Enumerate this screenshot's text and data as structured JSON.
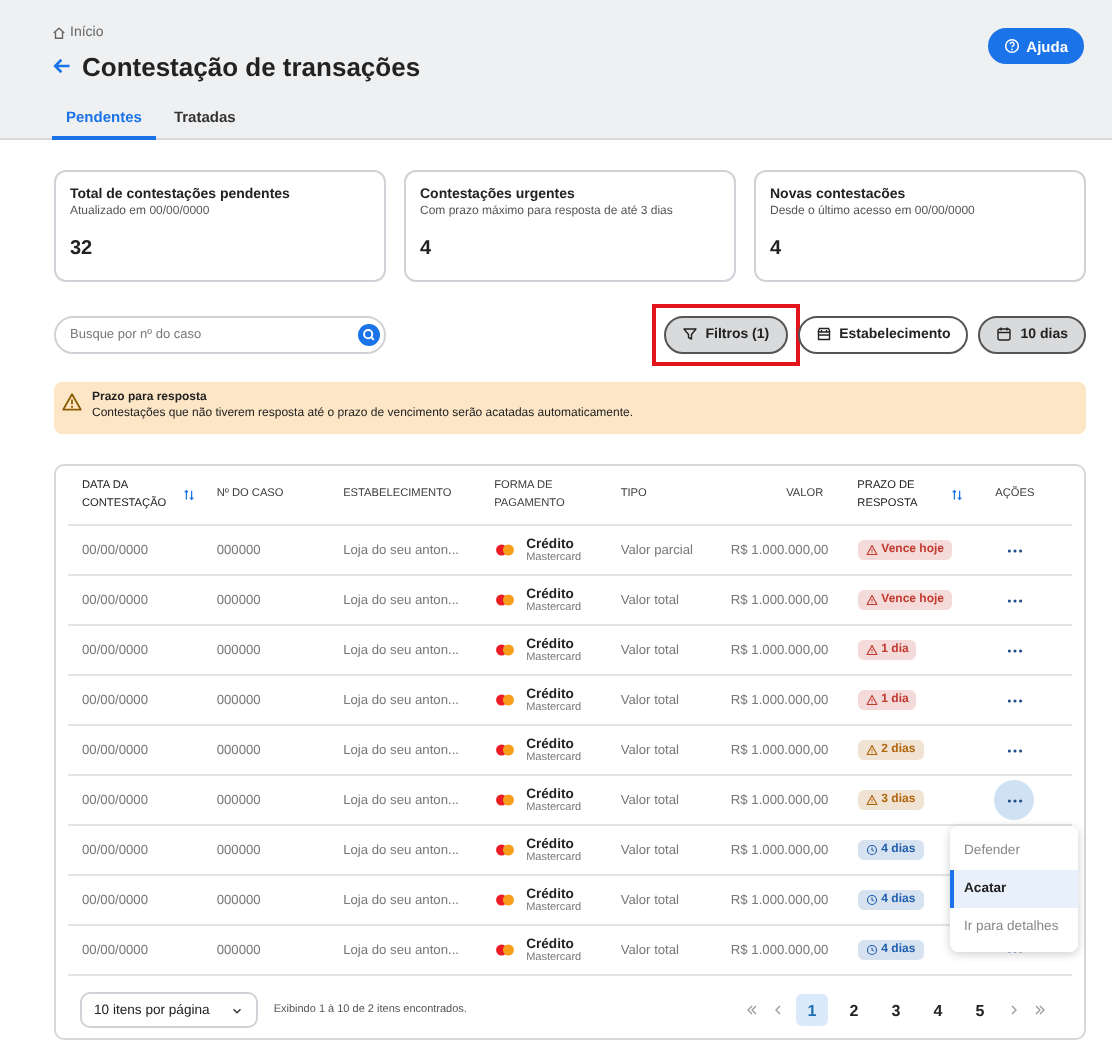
{
  "breadcrumb": "Início",
  "title": "Contestação de transações",
  "help_button": "Ajuda",
  "tabs": [
    {
      "label": "Pendentes",
      "selected": true
    },
    {
      "label": "Tratadas",
      "selected": false
    }
  ],
  "cards": [
    {
      "title": "Total de contestações pendentes",
      "subtitle": "Atualizado em 00/00/0000",
      "value": "32"
    },
    {
      "title": "Contestações urgentes",
      "subtitle": "Com prazo máximo para resposta de até 3 dias",
      "value": "4"
    },
    {
      "title": "Novas contestacões",
      "subtitle": "Desde o último acesso em 00/00/0000",
      "value": "4"
    }
  ],
  "search": {
    "placeholder": "Busque por nº do caso"
  },
  "filters": [
    {
      "kind": "filter",
      "label": "Filtros (1)",
      "active": true,
      "highlighted": true
    },
    {
      "kind": "store",
      "label": "Estabelecimento",
      "active": false,
      "highlighted": false
    },
    {
      "kind": "calendar",
      "label": "10 dias",
      "active": true,
      "highlighted": false
    }
  ],
  "alert": {
    "title": "Prazo para resposta",
    "text": "Contestações que não tiverem resposta até o prazo de vencimento serão acatadas automaticamente."
  },
  "table": {
    "columns": [
      {
        "label": "DATA DA CONTESTAÇÃO",
        "sortable": true
      },
      {
        "label": "Nº DO CASO",
        "sortable": false
      },
      {
        "label": "ESTABELECIMENTO",
        "sortable": false
      },
      {
        "label": "FORMA DE PAGAMENTO",
        "sortable": false
      },
      {
        "label": "TIPO",
        "sortable": false
      },
      {
        "label": "VALOR",
        "sortable": false
      },
      {
        "label": "PRAZO DE RESPOSTA",
        "sortable": true
      },
      {
        "label": "AÇÕES",
        "sortable": false
      }
    ],
    "rows": [
      {
        "date": "00/00/0000",
        "case": "000000",
        "store": "Loja do seu anton...",
        "payment": "Crédito",
        "brand": "Mastercard",
        "type": "Valor parcial",
        "value": "R$ 1.000.000,00",
        "deadline": "Vence hoje",
        "kind": "warning",
        "color": "#c2392f",
        "actions": true,
        "menu_open": false
      },
      {
        "date": "00/00/0000",
        "case": "000000",
        "store": "Loja do seu anton...",
        "payment": "Crédito",
        "brand": "Mastercard",
        "type": "Valor total",
        "value": "R$ 1.000.000,00",
        "deadline": "Vence hoje",
        "kind": "warning",
        "color": "#c2392f",
        "actions": true,
        "menu_open": false
      },
      {
        "date": "00/00/0000",
        "case": "000000",
        "store": "Loja do seu anton...",
        "payment": "Crédito",
        "brand": "Mastercard",
        "type": "Valor total",
        "value": "R$ 1.000.000,00",
        "deadline": "1 dia",
        "kind": "warning",
        "color": "#c2392f",
        "actions": true,
        "menu_open": false
      },
      {
        "date": "00/00/0000",
        "case": "000000",
        "store": "Loja do seu anton...",
        "payment": "Crédito",
        "brand": "Mastercard",
        "type": "Valor total",
        "value": "R$ 1.000.000,00",
        "deadline": "1 dia",
        "kind": "warning",
        "color": "#c2392f",
        "actions": true,
        "menu_open": false
      },
      {
        "date": "00/00/0000",
        "case": "000000",
        "store": "Loja do seu anton...",
        "payment": "Crédito",
        "brand": "Mastercard",
        "type": "Valor total",
        "value": "R$ 1.000.000,00",
        "deadline": "2 dias",
        "kind": "warning",
        "color": "#b0650a",
        "actions": true,
        "menu_open": false
      },
      {
        "date": "00/00/0000",
        "case": "000000",
        "store": "Loja do seu anton...",
        "payment": "Crédito",
        "brand": "Mastercard",
        "type": "Valor total",
        "value": "R$ 1.000.000,00",
        "deadline": "3 dias",
        "kind": "warning",
        "color": "#b0650a",
        "actions": true,
        "menu_open": true
      },
      {
        "date": "00/00/0000",
        "case": "000000",
        "store": "Loja do seu anton...",
        "payment": "Crédito",
        "brand": "Mastercard",
        "type": "Valor total",
        "value": "R$ 1.000.000,00",
        "deadline": "4 dias",
        "kind": "clock",
        "color": "#1f5fae",
        "actions": false,
        "menu_open": false
      },
      {
        "date": "00/00/0000",
        "case": "000000",
        "store": "Loja do seu anton...",
        "payment": "Crédito",
        "brand": "Mastercard",
        "type": "Valor total",
        "value": "R$ 1.000.000,00",
        "deadline": "4 dias",
        "kind": "clock",
        "color": "#1f5fae",
        "actions": false,
        "menu_open": false
      },
      {
        "date": "00/00/0000",
        "case": "000000",
        "store": "Loja do seu anton...",
        "payment": "Crédito",
        "brand": "Mastercard",
        "type": "Valor total",
        "value": "R$ 1.000.000,00",
        "deadline": "4 dias",
        "kind": "clock",
        "color": "#1f5fae",
        "actions": true,
        "menu_open": false
      }
    ]
  },
  "action_menu": [
    {
      "label": "Defender",
      "selected": false
    },
    {
      "label": "Acatar",
      "selected": true
    },
    {
      "label": "Ir para detalhes",
      "selected": false
    }
  ],
  "page_size": "10 itens por página",
  "results_info": "Exibindo 1 à 10 de 2 itens encontrados.",
  "pages": [
    {
      "label": "1",
      "selected": true
    },
    {
      "label": "2",
      "selected": false
    },
    {
      "label": "3",
      "selected": false
    },
    {
      "label": "4",
      "selected": false
    },
    {
      "label": "5",
      "selected": false
    }
  ]
}
